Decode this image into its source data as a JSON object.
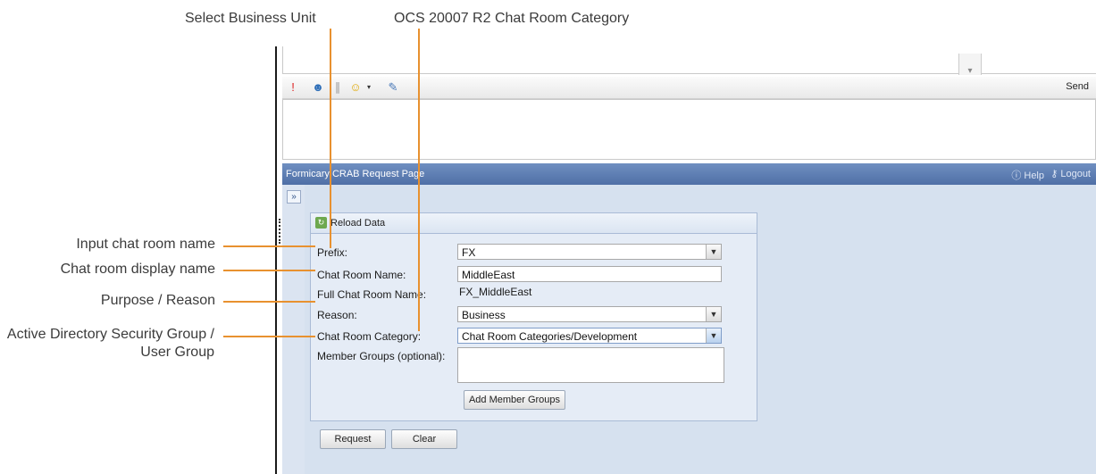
{
  "callouts": {
    "select_business_unit": "Select Business Unit",
    "chat_room_category": "OCS 20007 R2 Chat Room Category",
    "input_chat_room_name": "Input chat room name",
    "chat_room_display_name": "Chat room display name",
    "purpose_reason": "Purpose / Reason",
    "active_directory": "Active Directory Security Group / User Group"
  },
  "toolbar": {
    "send_label": "Send"
  },
  "titlebar": {
    "title": "Formicary CRAB Request Page",
    "help": "Help",
    "logout": "Logout"
  },
  "panel": {
    "expand_glyph": "»",
    "reload_label": "Reload Data"
  },
  "form": {
    "prefix_label": "Prefix:",
    "prefix_value": "FX",
    "chat_room_name_label": "Chat Room Name:",
    "chat_room_name_value": "MiddleEast",
    "full_chat_room_name_label": "Full Chat Room Name:",
    "full_chat_room_name_value": "FX_MiddleEast",
    "reason_label": "Reason:",
    "reason_value": "Business",
    "category_label": "Chat Room Category:",
    "category_value": "Chat Room Categories/Development",
    "member_groups_label": "Member Groups (optional):",
    "add_member_groups_label": "Add Member Groups",
    "request_label": "Request",
    "clear_label": "Clear"
  },
  "colors": {
    "callout_line": "#e8912f",
    "titlebar": "#5a79ae",
    "panel_bg": "#d6e1ef"
  }
}
